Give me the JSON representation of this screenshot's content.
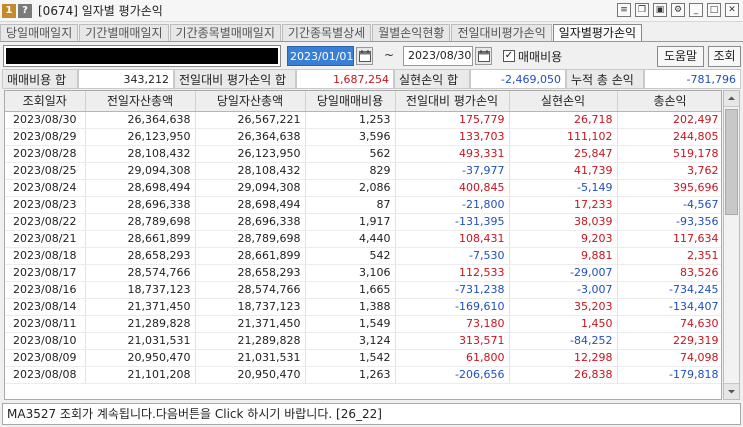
{
  "titlebar": {
    "badge_number": "1",
    "badge_help": "?",
    "title": "[0674] 일자별 평가손익"
  },
  "tabs": [
    {
      "label": "당일매매일지",
      "active": false
    },
    {
      "label": "기간별매매일지",
      "active": false
    },
    {
      "label": "기간종목별매매일지",
      "active": false
    },
    {
      "label": "기간종목별상세",
      "active": false
    },
    {
      "label": "월별손익현황",
      "active": false
    },
    {
      "label": "전일대비평가손익",
      "active": false
    },
    {
      "label": "일자별평가손익",
      "active": true
    }
  ],
  "query": {
    "date_from": "2023/01/01",
    "tilde": "~",
    "date_to": "2023/08/30",
    "include_fees_checked": true,
    "include_fees_label": "매매비용",
    "help_label": "도움말",
    "query_label": "조회"
  },
  "summary": {
    "fee_total_label": "매매비용 합",
    "fee_total_value": "343,212",
    "pnl_vs_prev_total_label": "전일대비 평가손익 합",
    "pnl_vs_prev_total_value": "1,687,254",
    "realized_total_label": "실현손익 합",
    "realized_total_value": "-2,469,050",
    "cumulative_total_label": "누적 총 손익",
    "cumulative_total_value": "-781,796"
  },
  "table": {
    "columns": [
      "조회일자",
      "전일자산총액",
      "당일자산총액",
      "당일매매비용",
      "전일대비 평가손익",
      "실현손익",
      "총손익"
    ],
    "rows": [
      [
        "2023/08/30",
        "26,364,638",
        "26,567,221",
        "1,253",
        "175,779",
        "26,718",
        "202,497"
      ],
      [
        "2023/08/29",
        "26,123,950",
        "26,364,638",
        "3,596",
        "133,703",
        "111,102",
        "244,805"
      ],
      [
        "2023/08/28",
        "28,108,432",
        "26,123,950",
        "562",
        "493,331",
        "25,847",
        "519,178"
      ],
      [
        "2023/08/25",
        "29,094,308",
        "28,108,432",
        "829",
        "-37,977",
        "41,739",
        "3,762"
      ],
      [
        "2023/08/24",
        "28,698,494",
        "29,094,308",
        "2,086",
        "400,845",
        "-5,149",
        "395,696"
      ],
      [
        "2023/08/23",
        "28,696,338",
        "28,698,494",
        "87",
        "-21,800",
        "17,233",
        "-4,567"
      ],
      [
        "2023/08/22",
        "28,789,698",
        "28,696,338",
        "1,917",
        "-131,395",
        "38,039",
        "-93,356"
      ],
      [
        "2023/08/21",
        "28,661,899",
        "28,789,698",
        "4,440",
        "108,431",
        "9,203",
        "117,634"
      ],
      [
        "2023/08/18",
        "28,658,293",
        "28,661,899",
        "542",
        "-7,530",
        "9,881",
        "2,351"
      ],
      [
        "2023/08/17",
        "28,574,766",
        "28,658,293",
        "3,106",
        "112,533",
        "-29,007",
        "83,526"
      ],
      [
        "2023/08/16",
        "18,737,123",
        "28,574,766",
        "1,665",
        "-731,238",
        "-3,007",
        "-734,245"
      ],
      [
        "2023/08/14",
        "21,371,450",
        "18,737,123",
        "1,388",
        "-169,610",
        "35,203",
        "-134,407"
      ],
      [
        "2023/08/11",
        "21,289,828",
        "21,371,450",
        "1,549",
        "73,180",
        "1,450",
        "74,630"
      ],
      [
        "2023/08/10",
        "21,031,531",
        "21,289,828",
        "3,124",
        "313,571",
        "-84,252",
        "229,319"
      ],
      [
        "2023/08/09",
        "20,950,470",
        "21,031,531",
        "1,542",
        "61,800",
        "12,298",
        "74,098"
      ],
      [
        "2023/08/08",
        "21,101,208",
        "20,950,470",
        "1,263",
        "-206,656",
        "26,838",
        "-179,818"
      ]
    ]
  },
  "status": {
    "message": "MA3527 조회가 계속됩니다.다음버튼을 Click 하시기 바랍니다. [26_22]"
  },
  "colors": {
    "positive": "#c8141e",
    "negative": "#1f4fc0",
    "selected_date_bg": "#3a7fd6"
  }
}
